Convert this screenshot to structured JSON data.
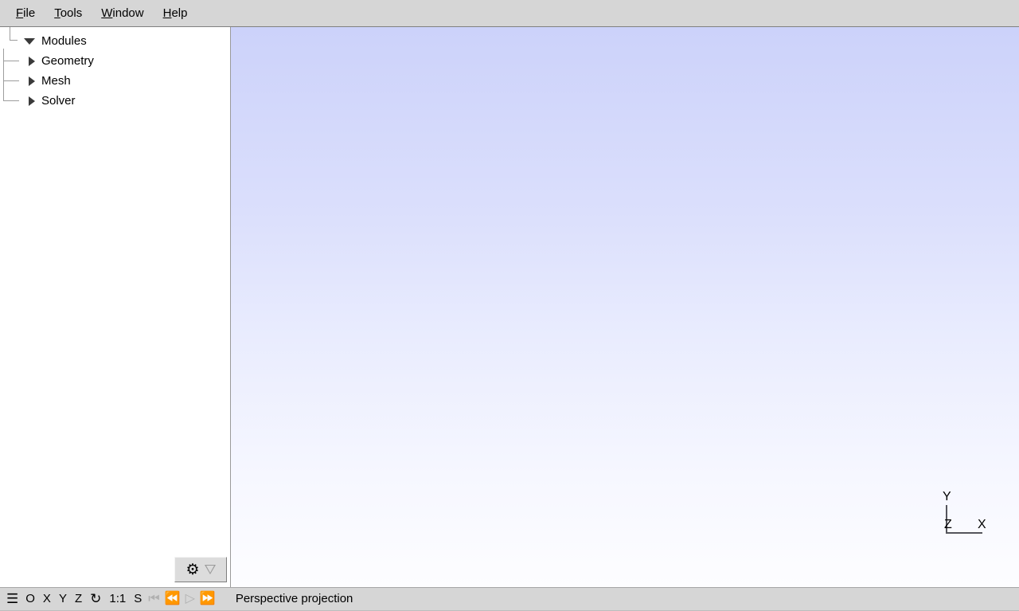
{
  "menubar": {
    "items": [
      {
        "label": "File",
        "mnemonic": "F",
        "rest": "ile"
      },
      {
        "label": "Tools",
        "mnemonic": "T",
        "rest": "ools"
      },
      {
        "label": "Window",
        "mnemonic": "W",
        "rest": "indow"
      },
      {
        "label": "Help",
        "mnemonic": "H",
        "rest": "elp"
      }
    ]
  },
  "sidebar": {
    "tree": {
      "root": {
        "label": "Modules",
        "expanded": true
      },
      "children": [
        {
          "label": "Geometry",
          "expanded": false
        },
        {
          "label": "Mesh",
          "expanded": false
        },
        {
          "label": "Solver",
          "expanded": false
        }
      ]
    },
    "footer": {
      "gear_icon": "gear-icon",
      "gear_glyph": "⚙",
      "dropdown_icon": "chevron-down-icon"
    }
  },
  "viewport": {
    "background_top": "#ccd2fa",
    "background_bottom": "#fdfdff",
    "axis_triad": {
      "y_label": "Y",
      "z_label": "Z",
      "x_label": "X"
    }
  },
  "statusbar": {
    "icons": [
      {
        "name": "menu-icon",
        "glyph": "☰",
        "disabled": false
      },
      {
        "name": "origin-icon",
        "glyph": "O",
        "disabled": false
      },
      {
        "name": "axis-x-icon",
        "glyph": "X",
        "disabled": false
      },
      {
        "name": "axis-y-icon",
        "glyph": "Y",
        "disabled": false
      },
      {
        "name": "axis-z-icon",
        "glyph": "Z",
        "disabled": false
      },
      {
        "name": "rotate-icon",
        "glyph": "↻",
        "disabled": false
      },
      {
        "name": "zoom-ratio",
        "glyph": "1:1",
        "disabled": false
      },
      {
        "name": "scale-icon",
        "glyph": "S",
        "disabled": false
      }
    ],
    "playback": [
      {
        "name": "skip-to-start-icon",
        "glyph": "⏮"
      },
      {
        "name": "step-back-icon",
        "glyph": "⏪"
      },
      {
        "name": "play-icon",
        "glyph": "▷"
      },
      {
        "name": "step-forward-icon",
        "glyph": "⏩"
      }
    ],
    "message": "Perspective projection"
  }
}
